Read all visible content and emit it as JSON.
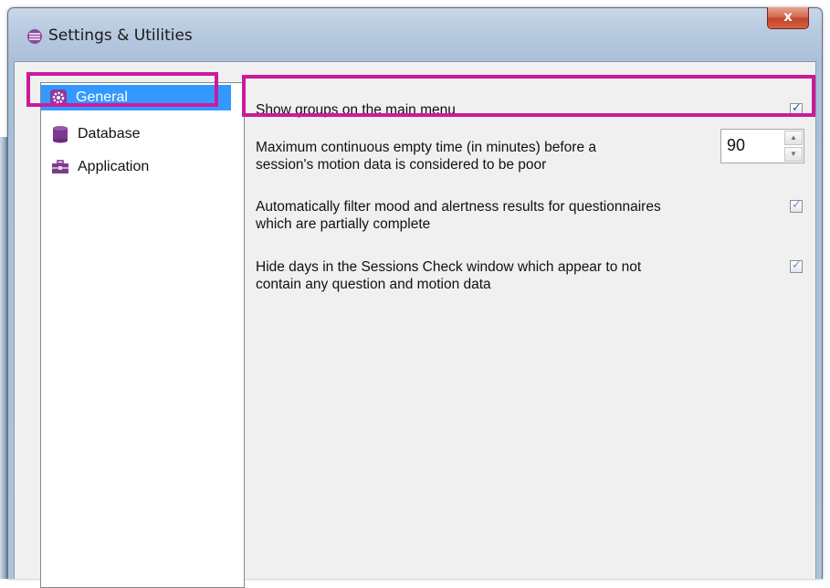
{
  "window": {
    "title": "Settings & Utilities",
    "close_label": "x"
  },
  "sidebar": {
    "items": [
      {
        "label": "General",
        "icon": "gear-icon",
        "selected": true
      },
      {
        "label": "Database",
        "icon": "database-icon",
        "selected": false
      },
      {
        "label": "Application",
        "icon": "toolbox-icon",
        "selected": false
      }
    ]
  },
  "settings": {
    "show_groups": {
      "label": "Show groups on the main menu",
      "checked": true
    },
    "empty_time": {
      "line1": "Maximum continuous empty time (in minutes) before a",
      "line2": "session's motion data is considered to be poor",
      "value": "90"
    },
    "filter_mood": {
      "line1": "Automatically filter mood and alertness results for questionnaires",
      "line2": "which are partially complete",
      "checked": true
    },
    "hide_days": {
      "line1": "Hide days in the Sessions Check window which appear to not",
      "line2": "contain any question and motion data",
      "checked": true
    }
  },
  "colors": {
    "highlight": "#cc1a9d",
    "selection": "#3399ff",
    "accent": "#7a3c8c"
  }
}
